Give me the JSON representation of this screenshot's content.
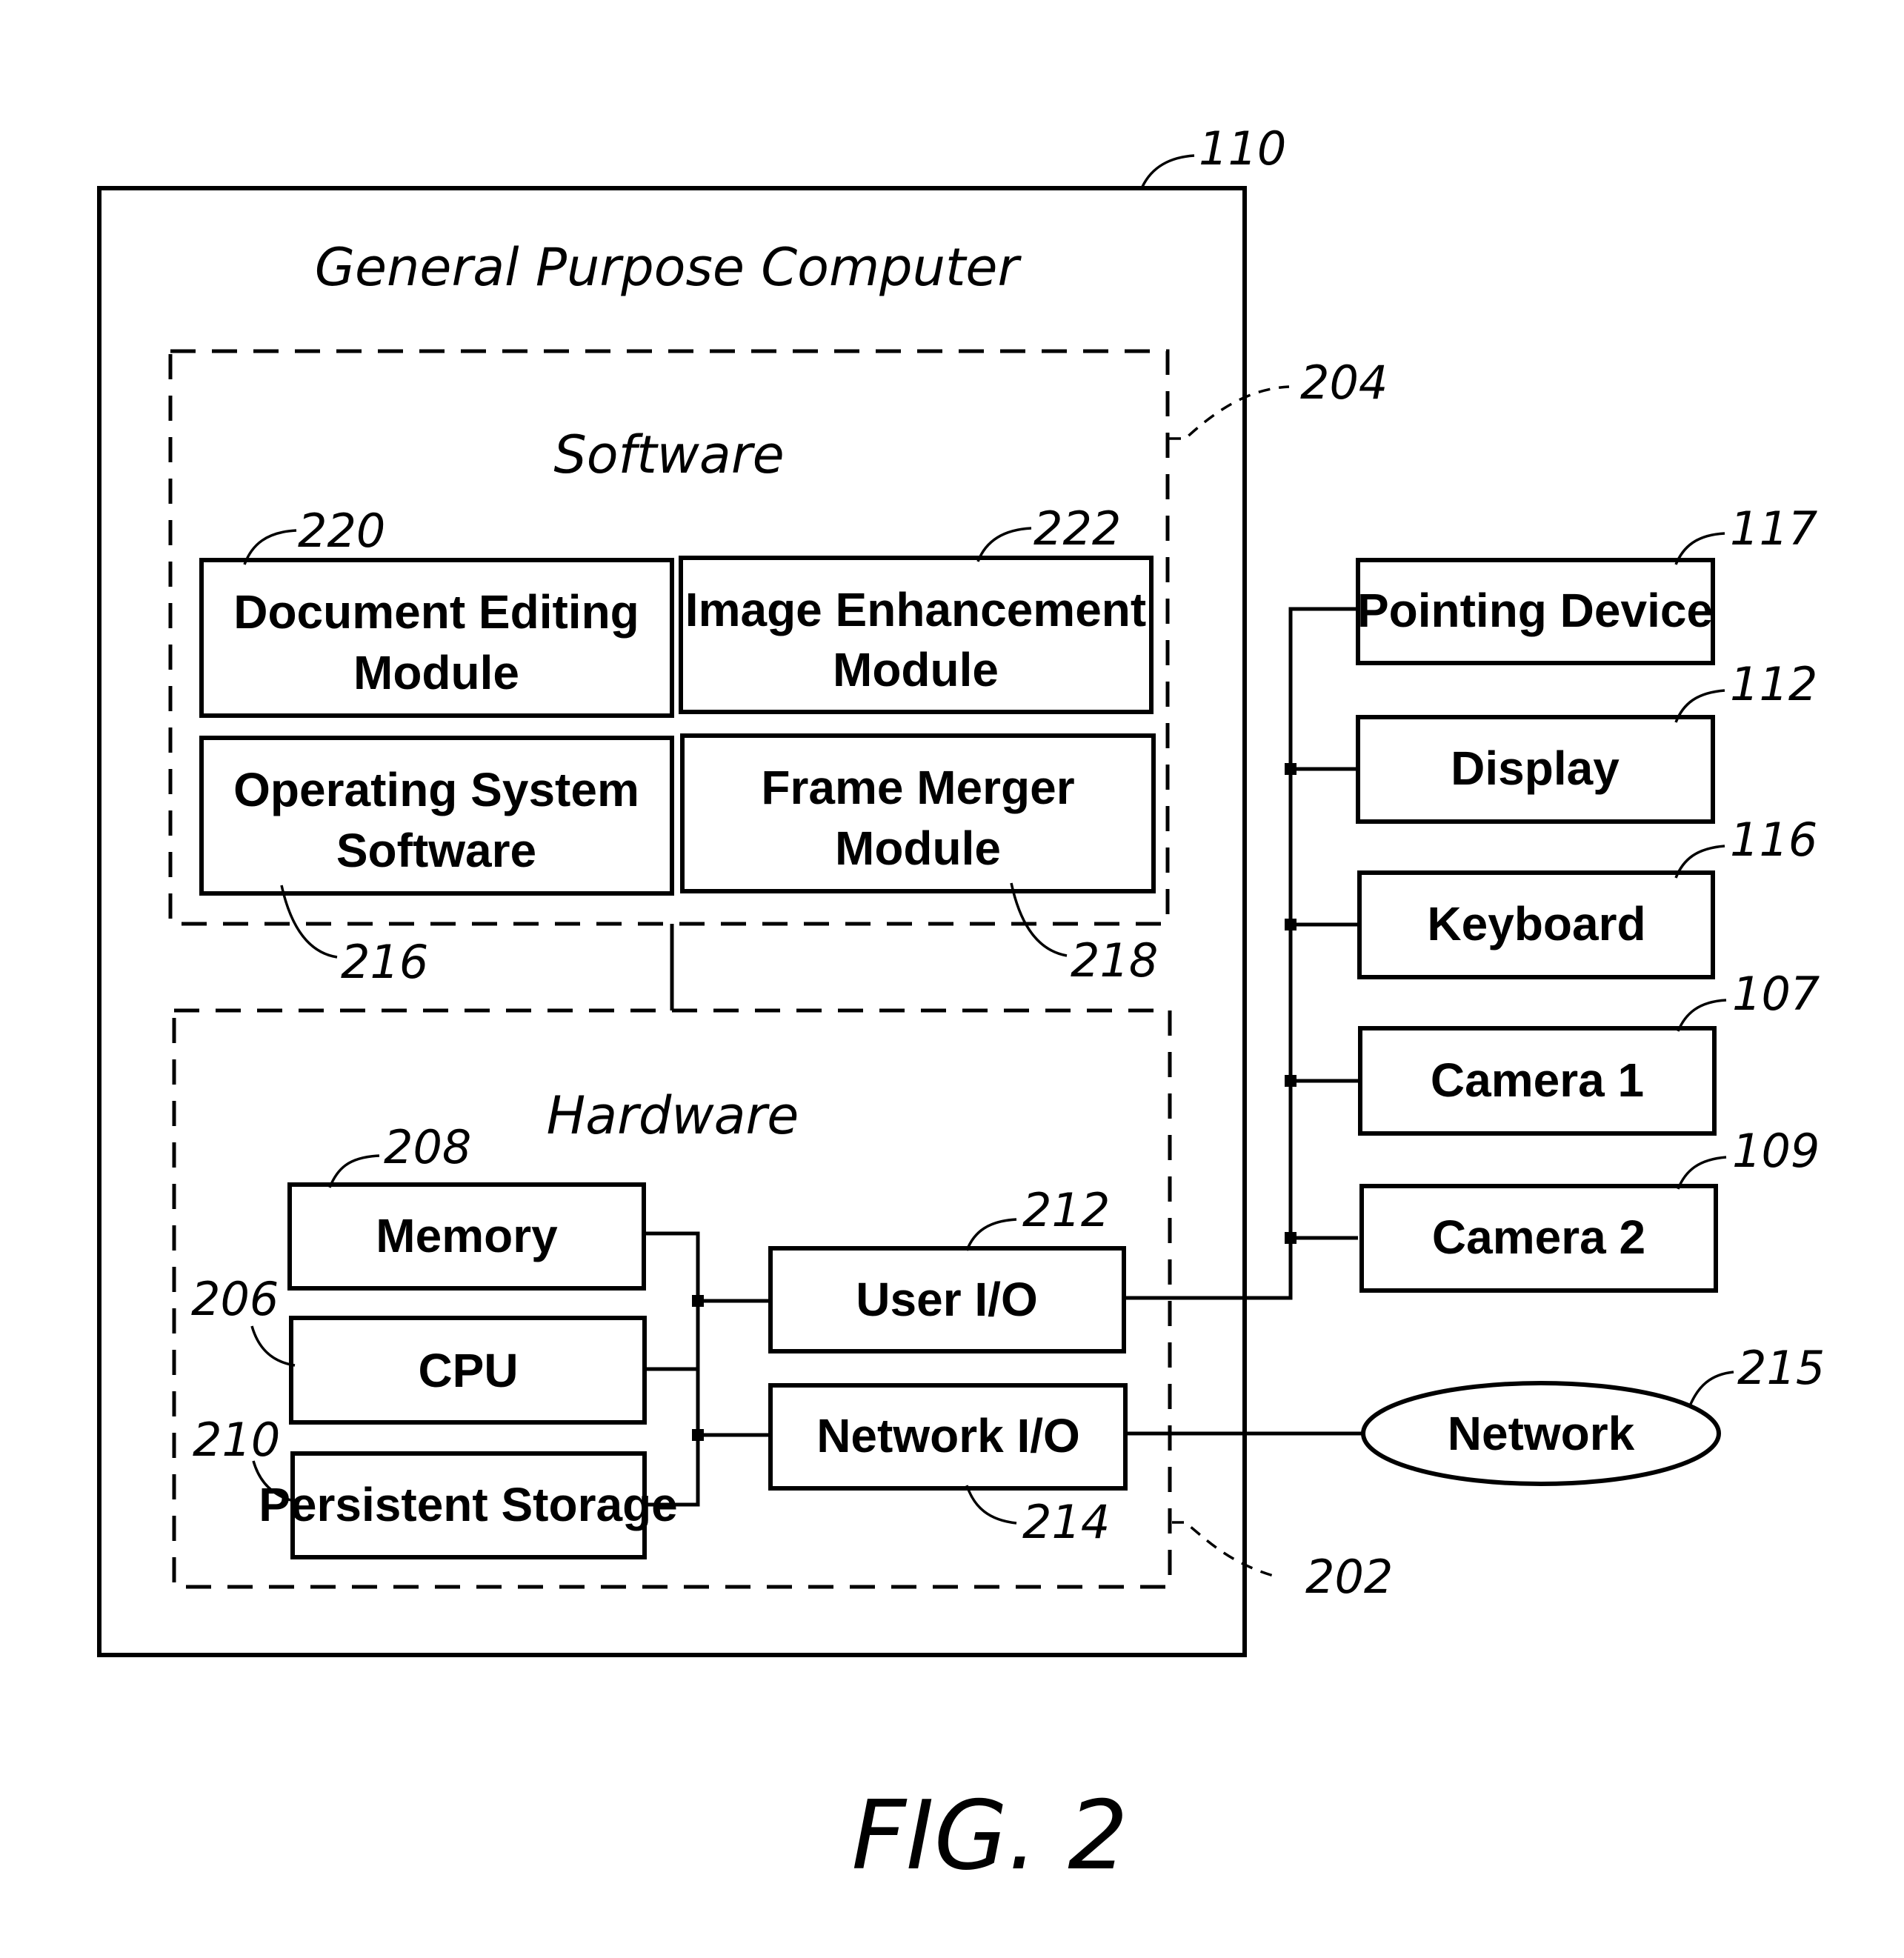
{
  "figure": {
    "caption": "FIG. 2",
    "computer": {
      "title": "General Purpose Computer",
      "ref": "110"
    },
    "software": {
      "title": "Software",
      "ref": "204",
      "modules": [
        {
          "line1": "Document Editing",
          "line2": "Module",
          "ref": "220"
        },
        {
          "line1": "Image Enhancement",
          "line2": "Module",
          "ref": "222"
        },
        {
          "line1": "Operating System",
          "line2": "Software",
          "ref": "216"
        },
        {
          "line1": "Frame Merger",
          "line2": "Module",
          "ref": "218"
        }
      ]
    },
    "hardware": {
      "title": "Hardware",
      "ref": "202",
      "components": [
        {
          "label": "Memory",
          "ref": "208"
        },
        {
          "label": "CPU",
          "ref": "206"
        },
        {
          "label": "Persistent Storage",
          "ref": "210"
        },
        {
          "label": "User I/O",
          "ref": "212"
        },
        {
          "label": "Network I/O",
          "ref": "214"
        }
      ]
    },
    "peripherals": [
      {
        "label": "Pointing Device",
        "ref": "117"
      },
      {
        "label": "Display",
        "ref": "112"
      },
      {
        "label": "Keyboard",
        "ref": "116"
      },
      {
        "label": "Camera 1",
        "ref": "107"
      },
      {
        "label": "Camera 2",
        "ref": "109"
      }
    ],
    "network": {
      "label": "Network",
      "ref": "215"
    }
  }
}
